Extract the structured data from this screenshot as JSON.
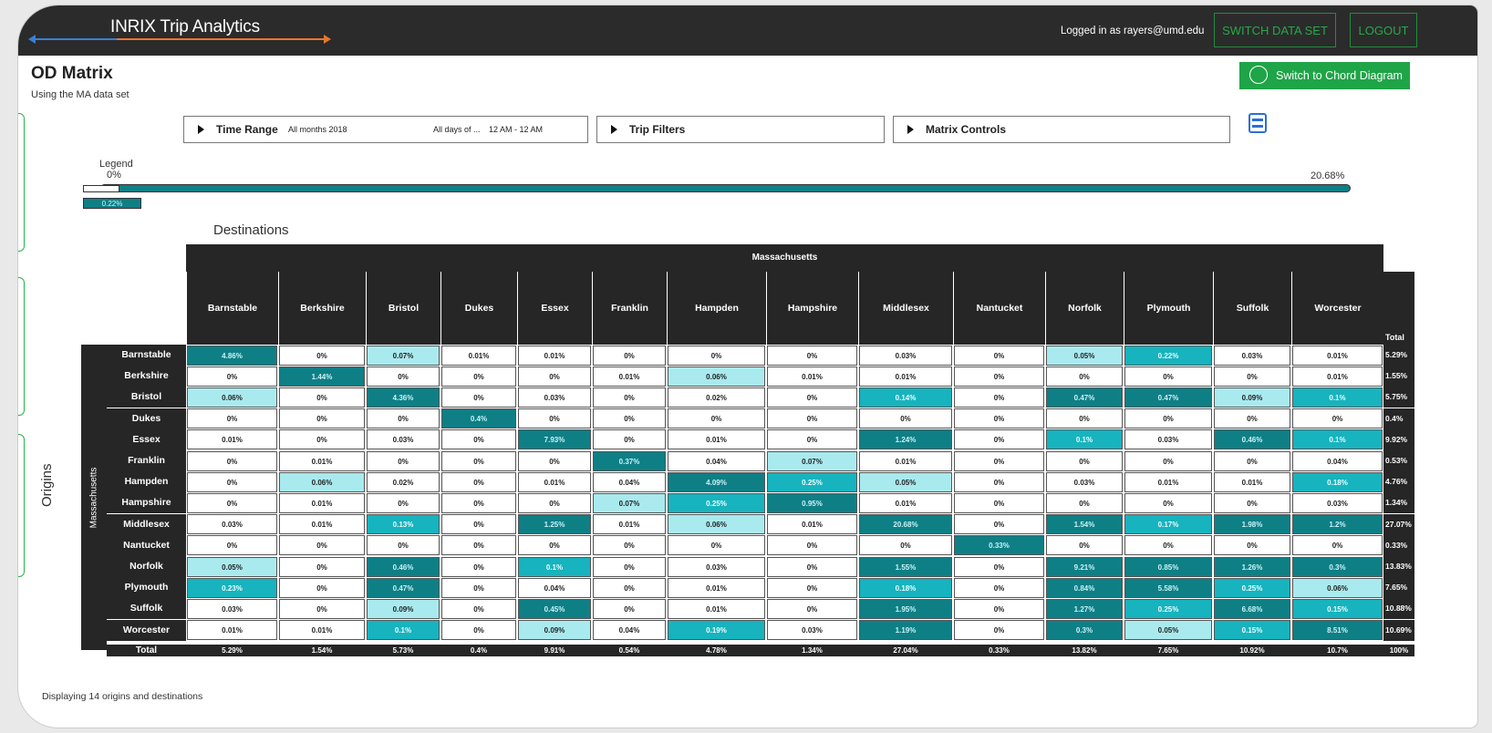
{
  "app": {
    "title": "INRIX Trip Analytics",
    "user_text": "Logged in as rayers@umd.edu",
    "switch_data_set": "SWITCH DATA SET",
    "logout": "LOGOUT"
  },
  "page": {
    "title": "OD Matrix",
    "subtitle": "Using the MA data set",
    "chord_button": "Switch to Chord Diagram",
    "footer": "Displaying 14 origins and destinations"
  },
  "filters": {
    "time_range_label": "Time Range",
    "months": "All months 2018",
    "days": "All days of ...",
    "hours": "12 AM - 12 AM",
    "trip_filters": "Trip Filters",
    "matrix_controls": "Matrix Controls"
  },
  "legend": {
    "title": "Legend",
    "min": "0%",
    "max": "20.68%",
    "marker": "0.22%"
  },
  "matrix": {
    "destinations_label": "Destinations",
    "origins_label": "Origins",
    "state": "Massachusetts",
    "total_label": "Total",
    "columns": [
      "Barnstable",
      "Berkshire",
      "Bristol",
      "Dukes",
      "Essex",
      "Franklin",
      "Hampden",
      "Hampshire",
      "Middlesex",
      "Nantucket",
      "Norfolk",
      "Plymouth",
      "Suffolk",
      "Worcester"
    ],
    "rows": [
      {
        "name": "Barnstable",
        "cells": [
          "4.86%",
          "0%",
          "0.07%",
          "0.01%",
          "0.01%",
          "0%",
          "0%",
          "0%",
          "0.03%",
          "0%",
          "0.05%",
          "0.22%",
          "0.03%",
          "0.01%"
        ],
        "total": "5.29%"
      },
      {
        "name": "Berkshire",
        "cells": [
          "0%",
          "1.44%",
          "0%",
          "0%",
          "0%",
          "0.01%",
          "0.06%",
          "0.01%",
          "0.01%",
          "0%",
          "0%",
          "0%",
          "0%",
          "0.01%"
        ],
        "total": "1.55%"
      },
      {
        "name": "Bristol",
        "cells": [
          "0.06%",
          "0%",
          "4.36%",
          "0%",
          "0.03%",
          "0%",
          "0.02%",
          "0%",
          "0.14%",
          "0%",
          "0.47%",
          "0.47%",
          "0.09%",
          "0.1%"
        ],
        "total": "5.75%"
      },
      {
        "name": "Dukes",
        "cells": [
          "0%",
          "0%",
          "0%",
          "0.4%",
          "0%",
          "0%",
          "0%",
          "0%",
          "0%",
          "0%",
          "0%",
          "0%",
          "0%",
          "0%"
        ],
        "total": "0.4%"
      },
      {
        "name": "Essex",
        "cells": [
          "0.01%",
          "0%",
          "0.03%",
          "0%",
          "7.93%",
          "0%",
          "0.01%",
          "0%",
          "1.24%",
          "0%",
          "0.1%",
          "0.03%",
          "0.46%",
          "0.1%"
        ],
        "total": "9.92%"
      },
      {
        "name": "Franklin",
        "cells": [
          "0%",
          "0.01%",
          "0%",
          "0%",
          "0%",
          "0.37%",
          "0.04%",
          "0.07%",
          "0.01%",
          "0%",
          "0%",
          "0%",
          "0%",
          "0.04%"
        ],
        "total": "0.53%"
      },
      {
        "name": "Hampden",
        "cells": [
          "0%",
          "0.06%",
          "0.02%",
          "0%",
          "0.01%",
          "0.04%",
          "4.09%",
          "0.25%",
          "0.05%",
          "0%",
          "0.03%",
          "0.01%",
          "0.01%",
          "0.18%"
        ],
        "total": "4.76%"
      },
      {
        "name": "Hampshire",
        "cells": [
          "0%",
          "0.01%",
          "0%",
          "0%",
          "0%",
          "0.07%",
          "0.25%",
          "0.95%",
          "0.01%",
          "0%",
          "0%",
          "0%",
          "0%",
          "0.03%"
        ],
        "total": "1.34%"
      },
      {
        "name": "Middlesex",
        "cells": [
          "0.03%",
          "0.01%",
          "0.13%",
          "0%",
          "1.25%",
          "0.01%",
          "0.06%",
          "0.01%",
          "20.68%",
          "0%",
          "1.54%",
          "0.17%",
          "1.98%",
          "1.2%"
        ],
        "total": "27.07%"
      },
      {
        "name": "Nantucket",
        "cells": [
          "0%",
          "0%",
          "0%",
          "0%",
          "0%",
          "0%",
          "0%",
          "0%",
          "0%",
          "0.33%",
          "0%",
          "0%",
          "0%",
          "0%"
        ],
        "total": "0.33%"
      },
      {
        "name": "Norfolk",
        "cells": [
          "0.05%",
          "0%",
          "0.46%",
          "0%",
          "0.1%",
          "0%",
          "0.03%",
          "0%",
          "1.55%",
          "0%",
          "9.21%",
          "0.85%",
          "1.26%",
          "0.3%"
        ],
        "total": "13.83%"
      },
      {
        "name": "Plymouth",
        "cells": [
          "0.23%",
          "0%",
          "0.47%",
          "0%",
          "0.04%",
          "0%",
          "0.01%",
          "0%",
          "0.18%",
          "0%",
          "0.84%",
          "5.58%",
          "0.25%",
          "0.06%"
        ],
        "total": "7.65%"
      },
      {
        "name": "Suffolk",
        "cells": [
          "0.03%",
          "0%",
          "0.09%",
          "0%",
          "0.45%",
          "0%",
          "0.01%",
          "0%",
          "1.95%",
          "0%",
          "1.27%",
          "0.25%",
          "6.68%",
          "0.15%"
        ],
        "total": "10.88%"
      },
      {
        "name": "Worcester",
        "cells": [
          "0.01%",
          "0.01%",
          "0.1%",
          "0%",
          "0.09%",
          "0.04%",
          "0.19%",
          "0.03%",
          "1.19%",
          "0%",
          "0.3%",
          "0.05%",
          "0.15%",
          "8.51%"
        ],
        "total": "10.69%"
      }
    ],
    "column_totals": [
      "5.29%",
      "1.54%",
      "5.73%",
      "0.4%",
      "9.91%",
      "0.54%",
      "4.78%",
      "1.34%",
      "27.04%",
      "0.33%",
      "13.82%",
      "7.65%",
      "10.92%",
      "10.7%"
    ],
    "grand_total": "100%"
  },
  "colors": {
    "accent_green": "#1fa447",
    "topbar": "#2b2b2b",
    "cell_dark": "#0f7f86",
    "cell_mid": "#17b3be",
    "cell_light": "#a9eaef"
  }
}
